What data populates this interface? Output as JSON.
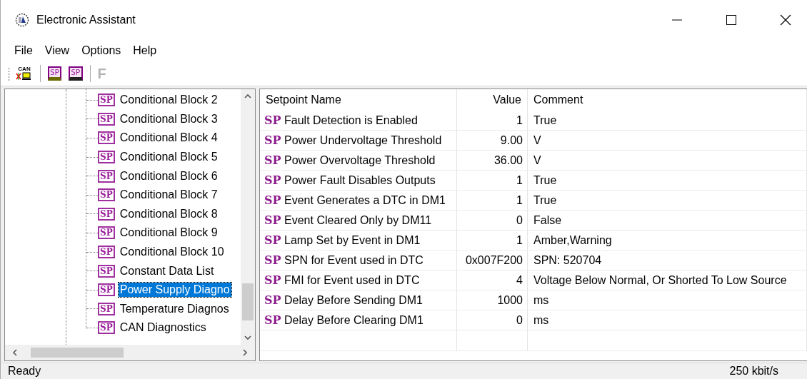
{
  "window": {
    "title": "Electronic Assistant"
  },
  "menu": [
    "File",
    "View",
    "Options",
    "Help"
  ],
  "toolbar": [
    {
      "kind": "can",
      "label": "CAN",
      "disabled": false
    },
    {
      "kind": "open",
      "label": "SP",
      "disabled": false
    },
    {
      "kind": "save",
      "label": "SP",
      "disabled": false
    },
    {
      "kind": "letter",
      "label": "F",
      "disabled": true
    }
  ],
  "tree": {
    "items": [
      {
        "badge": "SP",
        "label": "Conditional Block 2",
        "selected": false
      },
      {
        "badge": "SP",
        "label": "Conditional Block 3",
        "selected": false
      },
      {
        "badge": "SP",
        "label": "Conditional Block 4",
        "selected": false
      },
      {
        "badge": "SP",
        "label": "Conditional Block 5",
        "selected": false
      },
      {
        "badge": "SP",
        "label": "Conditional Block 6",
        "selected": false
      },
      {
        "badge": "SP",
        "label": "Conditional Block 7",
        "selected": false
      },
      {
        "badge": "SP",
        "label": "Conditional Block 8",
        "selected": false
      },
      {
        "badge": "SP",
        "label": "Conditional Block 9",
        "selected": false
      },
      {
        "badge": "SP",
        "label": "Conditional Block 10",
        "selected": false
      },
      {
        "badge": "SP",
        "label": "Constant Data List",
        "selected": false
      },
      {
        "badge": "SP",
        "label": "Power Supply Diagno",
        "selected": true
      },
      {
        "badge": "SP",
        "label": "Temperature Diagnos",
        "selected": false
      },
      {
        "badge": "SP",
        "label": "CAN Diagnostics",
        "selected": false
      }
    ]
  },
  "table": {
    "columns": [
      "Setpoint Name",
      "Value",
      "Comment"
    ],
    "rows": [
      {
        "badge": "SP",
        "name": "Fault Detection is Enabled",
        "value": "1",
        "comment": "True"
      },
      {
        "badge": "SP",
        "name": "Power Undervoltage Threshold",
        "value": "9.00",
        "comment": "V"
      },
      {
        "badge": "SP",
        "name": "Power Overvoltage Threshold",
        "value": "36.00",
        "comment": "V"
      },
      {
        "badge": "SP",
        "name": "Power Fault Disables Outputs",
        "value": "1",
        "comment": "True"
      },
      {
        "badge": "SP",
        "name": "Event Generates a DTC in DM1",
        "value": "1",
        "comment": "True"
      },
      {
        "badge": "SP",
        "name": "Event Cleared Only by DM11",
        "value": "0",
        "comment": "False"
      },
      {
        "badge": "SP",
        "name": "Lamp Set by Event in DM1",
        "value": "1",
        "comment": "Amber,Warning"
      },
      {
        "badge": "SP",
        "name": "SPN for Event used in DTC",
        "value": "0x007F200",
        "comment": "SPN: 520704"
      },
      {
        "badge": "SP",
        "name": "FMI for Event used in DTC",
        "value": "4",
        "comment": "Voltage Below Normal, Or Shorted To Low Source"
      },
      {
        "badge": "SP",
        "name": "Delay Before Sending DM1",
        "value": "1000",
        "comment": "ms"
      },
      {
        "badge": "SP",
        "name": "Delay Before Clearing DM1",
        "value": "0",
        "comment": "ms"
      }
    ]
  },
  "status_bar": {
    "left": "Ready",
    "right": "250 kbit/s"
  }
}
